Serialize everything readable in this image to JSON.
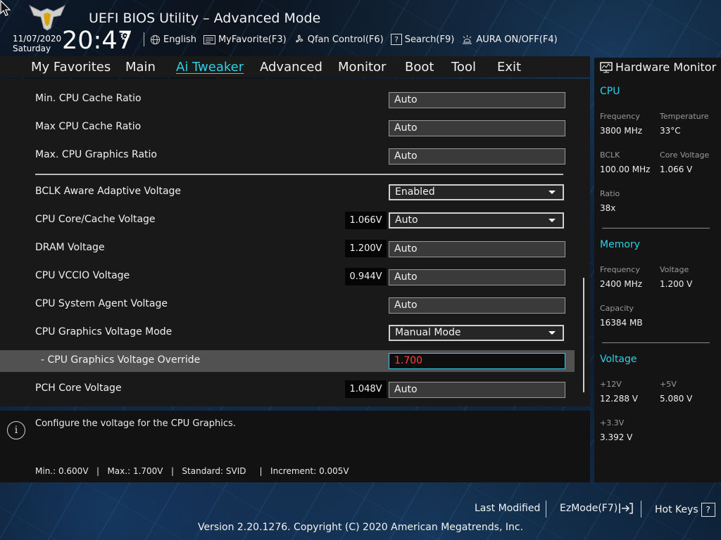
{
  "header": {
    "title": "UEFI BIOS Utility – Advanced Mode",
    "date": "11/07/2020",
    "day": "Saturday",
    "time": "20:47",
    "tools": {
      "language": "English",
      "favorite": "MyFavorite(F3)",
      "qfan": "Qfan Control(F6)",
      "search": "Search(F9)",
      "aura": "AURA ON/OFF(F4)"
    }
  },
  "menu": {
    "tabs": [
      "My Favorites",
      "Main",
      "Ai Tweaker",
      "Advanced",
      "Monitor",
      "Boot",
      "Tool",
      "Exit"
    ],
    "active": "Ai Tweaker"
  },
  "settings": {
    "min_cpu_cache_ratio": {
      "label": "Min. CPU Cache Ratio",
      "value": "Auto"
    },
    "max_cpu_cache_ratio": {
      "label": "Max CPU Cache Ratio",
      "value": "Auto"
    },
    "max_cpu_graphics_ratio": {
      "label": "Max. CPU Graphics Ratio",
      "value": "Auto"
    },
    "bclk_aware": {
      "label": "BCLK Aware Adaptive Voltage",
      "value": "Enabled"
    },
    "cpu_core_cache_voltage": {
      "label": "CPU Core/Cache Voltage",
      "reading": "1.066V",
      "value": "Auto"
    },
    "dram_voltage": {
      "label": "DRAM Voltage",
      "reading": "1.200V",
      "value": "Auto"
    },
    "cpu_vccio_voltage": {
      "label": "CPU VCCIO Voltage",
      "reading": "0.944V",
      "value": "Auto"
    },
    "cpu_sa_voltage": {
      "label": "CPU System Agent Voltage",
      "value": "Auto"
    },
    "cpu_graphics_voltage_mode": {
      "label": "CPU Graphics Voltage Mode",
      "value": "Manual Mode"
    },
    "cpu_graphics_voltage_override": {
      "label": "- CPU Graphics Voltage Override",
      "value": "1.700"
    },
    "pch_core_voltage": {
      "label": "PCH Core Voltage",
      "reading": "1.048V",
      "value": "Auto"
    }
  },
  "help": {
    "icon": "i",
    "text": "Configure the voltage for the CPU Graphics.",
    "limits": "Min.: 0.600V   |   Max.: 1.700V   |   Standard: SVID     |   Increment: 0.005V"
  },
  "hardware_monitor": {
    "title": "Hardware Monitor",
    "cpu": {
      "title": "CPU",
      "frequency_label": "Frequency",
      "frequency": "3800 MHz",
      "temperature_label": "Temperature",
      "temperature": "33°C",
      "bclk_label": "BCLK",
      "bclk": "100.00 MHz",
      "core_voltage_label": "Core Voltage",
      "core_voltage": "1.066 V",
      "ratio_label": "Ratio",
      "ratio": "38x"
    },
    "memory": {
      "title": "Memory",
      "frequency_label": "Frequency",
      "frequency": "2400 MHz",
      "voltage_label": "Voltage",
      "voltage": "1.200 V",
      "capacity_label": "Capacity",
      "capacity": "16384 MB"
    },
    "voltage": {
      "title": "Voltage",
      "v12_label": "+12V",
      "v12": "12.288 V",
      "v5_label": "+5V",
      "v5": "5.080 V",
      "v33_label": "+3.3V",
      "v33": "3.392 V"
    }
  },
  "footer": {
    "last_modified": "Last Modified",
    "ezmode": "EzMode(F7)",
    "hotkeys": "Hot Keys",
    "hotkeys_key": "?",
    "copyright": "Version 2.20.1276. Copyright (C) 2020 American Megatrends, Inc."
  },
  "colors": {
    "accent": "#2bd3e8",
    "override_value": "#ff4040"
  }
}
